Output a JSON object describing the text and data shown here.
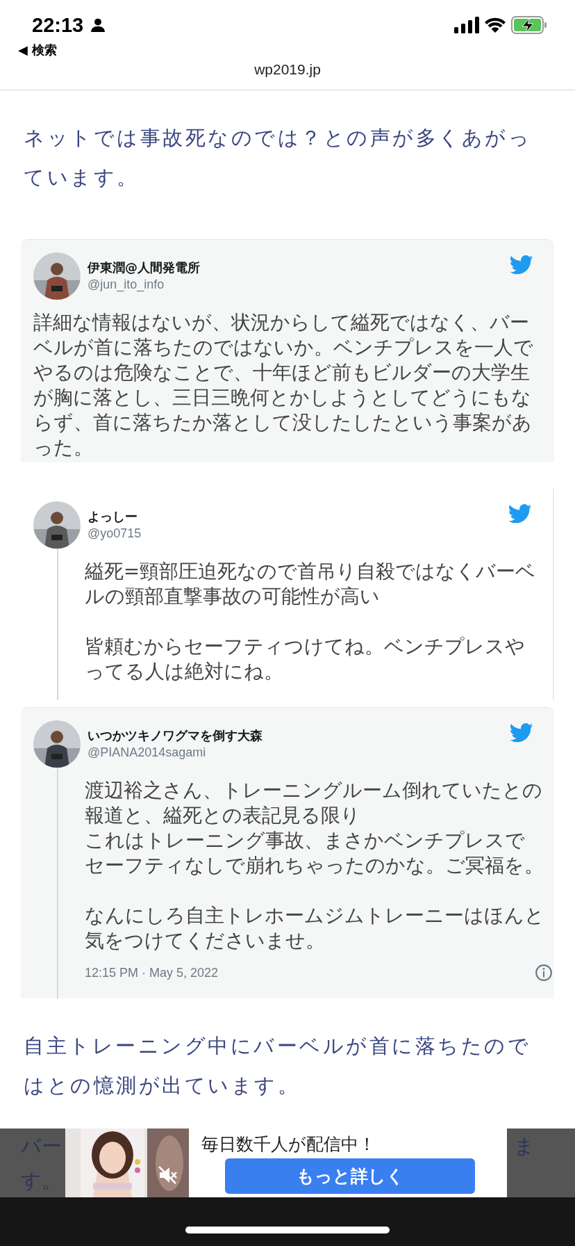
{
  "status_bar": {
    "time": "22:13",
    "back": "◀ 検索",
    "url": "wp2019.jp"
  },
  "intro": "ネットでは事故死なのでは？との声が多くあがっています。",
  "tweets": [
    {
      "name": "伊東潤@人間発電所",
      "handle": "@jun_ito_info",
      "shaded": true,
      "thread_line": false,
      "paragraphs": [
        [
          "詳細な情報はないが、状況からして縊死ではなく、バーベルが首に落ちたのではないか。ベンチプレスを一人でやるのは危険なことで、十年ほど前もビルダーの大学生が胸に落とし、三日三晩何とかしようとしてどうにもならず、首に落ちたか落として没したしたという事案があった。"
        ]
      ]
    },
    {
      "name": "よっしー",
      "handle": "@yo0715",
      "shaded": false,
      "thread_line": true,
      "paragraphs": [
        [
          "縊死=頸部圧迫死なので首吊り自殺ではなくバーベルの頸部直撃事故の可能性が高い"
        ],
        [
          "皆頼むからセーフティつけてね。ベンチプレスやってる人は絶対にね。"
        ]
      ]
    },
    {
      "name": "いつかツキノワグマを倒す大森",
      "handle": "@PIANA2014sagami",
      "shaded": true,
      "thread_line": true,
      "paragraphs": [
        [
          "渡辺裕之さん、トレーニングルーム倒れていたとの報道と、縊死との表記見る限り",
          "これはトレーニング事故、まさかベンチプレスでセーフティなしで崩れちゃったのかな。ご冥福を。"
        ],
        [
          "なんにしろ自主トレホームジムトレーニーはほんと気をつけてくださいませ。"
        ]
      ],
      "timestamp": "12:15 PM · May 5, 2022"
    }
  ],
  "outro": "自主トレーニング中にバーベルが首に落ちたのではとの憶測が出ています。",
  "covered_text": {
    "left": [
      "バー",
      "す。"
    ],
    "right": [
      "ま"
    ]
  },
  "ad": {
    "text": "毎日数千人が配信中！",
    "button": "もっと詳しく"
  }
}
